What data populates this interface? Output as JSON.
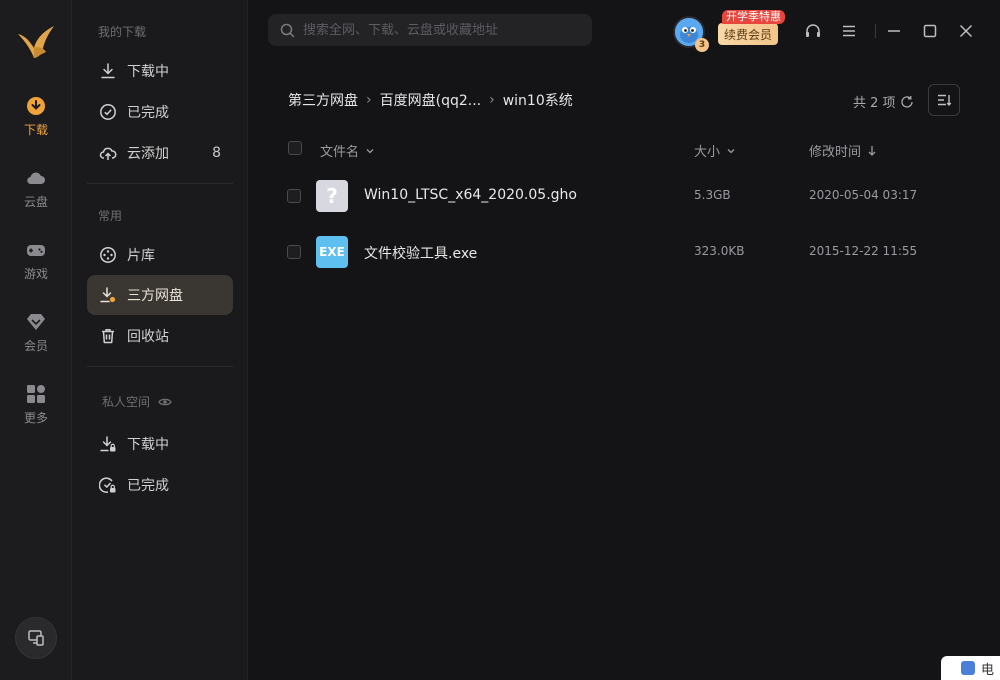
{
  "rail": {
    "items": [
      {
        "label": "下载",
        "icon": "download-circle-icon",
        "active": true
      },
      {
        "label": "云盘",
        "icon": "cloud-icon",
        "active": false
      },
      {
        "label": "游戏",
        "icon": "gamepad-icon",
        "active": false
      },
      {
        "label": "会员",
        "icon": "diamond-icon",
        "active": false
      },
      {
        "label": "更多",
        "icon": "grid-icon",
        "active": false
      }
    ],
    "bottom_button_icon": "remote-device-icon"
  },
  "sidebar": {
    "section_my_downloads": "我的下载",
    "downloading": "下载中",
    "completed": "已完成",
    "cloud_add": "云添加",
    "cloud_add_count": "8",
    "section_common": "常用",
    "library": "片库",
    "third_party_disk": "三方网盘",
    "recycle_bin": "回收站",
    "section_private": "私人空间",
    "private_downloading": "下载中",
    "private_completed": "已完成"
  },
  "search": {
    "placeholder": "搜索全网、下载、云盘或收藏地址"
  },
  "header": {
    "vip_tag": "开学季特惠",
    "vip_button": "续费会员",
    "avatar_level": "3"
  },
  "breadcrumb": {
    "items": [
      "第三方网盘",
      "百度网盘(qq2...",
      "win10系统"
    ]
  },
  "list": {
    "count_label": "共 2 项",
    "columns": {
      "name": "文件名",
      "size": "大小",
      "modified": "修改时间"
    },
    "rows": [
      {
        "icon": "unknown-file-icon",
        "icon_text": "?",
        "name": "Win10_LTSC_x64_2020.05.gho",
        "size": "5.3GB",
        "modified": "2020-05-04 03:17"
      },
      {
        "icon": "exe-file-icon",
        "icon_text": "EXE",
        "name": "文件校验工具.exe",
        "size": "323.0KB",
        "modified": "2015-12-22 11:55"
      }
    ]
  },
  "popup": {
    "text": "电"
  },
  "colors": {
    "accent": "#f0a33a",
    "background": "#141416",
    "sidebar": "#1a1a1c",
    "active_item": "#3a3631",
    "exe_icon": "#5fc0f0",
    "unknown_icon": "#d8d8e0"
  }
}
